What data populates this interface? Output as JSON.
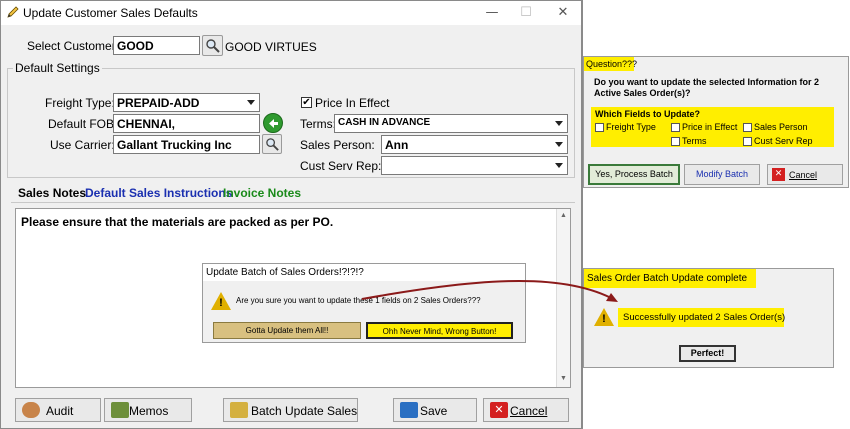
{
  "window": {
    "title": "Update Customer Sales Defaults",
    "minimize": "—",
    "maximize": "☐",
    "close": "✕"
  },
  "customer": {
    "label": "Select Customer:",
    "code": "GOOD",
    "name": "GOOD VIRTUES"
  },
  "defaults": {
    "legend": "Default Settings",
    "freight_type_label": "Freight Type:",
    "freight_type": "PREPAID-ADD",
    "fob_label": "Default FOB:",
    "fob": "CHENNAI,",
    "carrier_label": "Use Carrier:",
    "carrier": "Gallant Trucking Inc",
    "price_in_effect_label": "Price In Effect",
    "price_in_effect_checked": "✔",
    "terms_label": "Terms:",
    "terms": "CASH IN ADVANCE",
    "sales_person_label": "Sales Person:",
    "sales_person": "Ann",
    "cust_serv_rep_label": "Cust Serv Rep:",
    "cust_serv_rep": ""
  },
  "tabs": [
    {
      "label": "Sales Notes",
      "color": "#000000"
    },
    {
      "label": "Default Sales Instructions",
      "color": "#1a2fb0"
    },
    {
      "label": "Invoice Notes",
      "color": "#1a8a1a"
    }
  ],
  "notes_text": "Please ensure that the  materials are packed as per PO.",
  "buttons": {
    "audit": "Audit",
    "memos": "Memos",
    "batch_update": "Batch Update Sales",
    "save": "Save",
    "cancel": "Cancel"
  },
  "confirm_dialog": {
    "title": "Update Batch of Sales Orders!?!?!?",
    "message": "Are you sure you want to update these 1 fields on 2 Sales Orders???",
    "yes_button": "Gotta Update them All!!",
    "no_button": "Ohh Never Mind, Wrong Button!"
  },
  "question_dialog": {
    "title": "Question???",
    "message": "Do you want to update the selected Information for 2 Active Sales Order(s)?",
    "fields_label": "Which Fields to Update?",
    "fields": [
      "Freight Type",
      "Price in Effect",
      "Sales Person",
      "Terms",
      "Cust Serv Rep"
    ],
    "yes_button": "Yes, Process Batch",
    "modify_button": "Modify Batch",
    "cancel_button": "Cancel"
  },
  "complete_dialog": {
    "title": "Sales Order Batch Update complete",
    "message": "Successfully updated 2 Sales Order(s)",
    "ok_button": "Perfect!"
  },
  "colors": {
    "highlight": "#ffee00",
    "arrow": "#8b1a1a",
    "cancel_red": "#d42020"
  }
}
